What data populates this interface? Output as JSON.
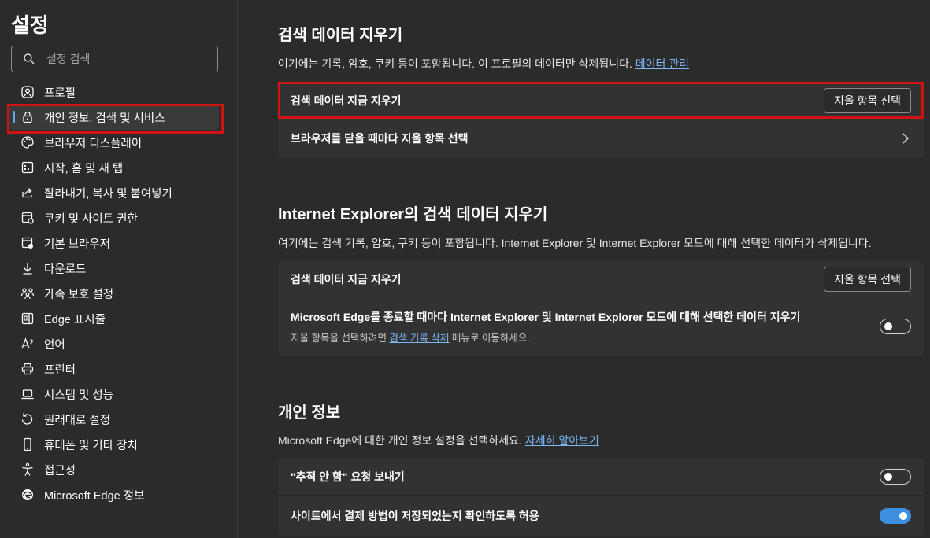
{
  "sidebar": {
    "title": "설정",
    "search_placeholder": "설정 검색",
    "items": [
      {
        "label": "프로필",
        "icon": "profile-icon"
      },
      {
        "label": "개인 정보, 검색 및 서비스",
        "icon": "lock-icon",
        "active": true
      },
      {
        "label": "브라우저 디스플레이",
        "icon": "palette-icon"
      },
      {
        "label": "시작, 홈 및 새 탭",
        "icon": "grid-icon"
      },
      {
        "label": "잘라내기, 복사 및 붙여넣기",
        "icon": "share-icon"
      },
      {
        "label": "쿠키 및 사이트 권한",
        "icon": "site-permissions-icon"
      },
      {
        "label": "기본 브라우저",
        "icon": "browser-icon"
      },
      {
        "label": "다운로드",
        "icon": "download-icon"
      },
      {
        "label": "가족 보호 설정",
        "icon": "family-icon"
      },
      {
        "label": "Edge 표시줄",
        "icon": "edge-bar-icon"
      },
      {
        "label": "언어",
        "icon": "language-icon"
      },
      {
        "label": "프린터",
        "icon": "printer-icon"
      },
      {
        "label": "시스템 및 성능",
        "icon": "laptop-icon"
      },
      {
        "label": "원래대로 설정",
        "icon": "reset-icon"
      },
      {
        "label": "휴대폰 및 기타 장치",
        "icon": "phone-icon"
      },
      {
        "label": "접근성",
        "icon": "accessibility-icon"
      },
      {
        "label": "Microsoft Edge 정보",
        "icon": "edge-logo-icon"
      }
    ]
  },
  "clear_data": {
    "title": "검색 데이터 지우기",
    "desc": "여기에는 기록, 암호, 쿠키 등이 포함됩니다. 이 프로필의 데이터만 삭제됩니다.",
    "desc_link": "데이터 관리",
    "row1_label": "검색 데이터 지금 지우기",
    "row1_button": "지울 항목 선택",
    "row2_label": "브라우저를 닫을 때마다 지울 항목 선택"
  },
  "ie_data": {
    "title": "Internet Explorer의 검색 데이터 지우기",
    "desc": "여기에는 검색 기록, 암호, 쿠키 등이 포함됩니다. Internet Explorer 및 Internet Explorer 모드에 대해 선택한 데이터가 삭제됩니다.",
    "row1_label": "검색 데이터 지금 지우기",
    "row1_button": "지울 항목 선택",
    "row2_label": "Microsoft Edge를 종료할 때마다 Internet Explorer 및 Internet Explorer 모드에 대해 선택한 데이터 지우기",
    "row2_sub_pre": "지울 항목을 선택하려면",
    "row2_sub_link": "검색 기록 삭제",
    "row2_sub_post": "메뉴로 이동하세요.",
    "row2_toggle_on": false
  },
  "privacy": {
    "title": "개인 정보",
    "desc": "Microsoft Edge에 대한 개인 정보 설정을 선택하세요.",
    "desc_link": "자세히 알아보기",
    "row1_label": "\"추적 안 함\" 요청 보내기",
    "row1_toggle_on": false,
    "row2_label": "사이트에서 결제 방법이 저장되었는지 확인하도록 허용",
    "row2_toggle_on": true
  },
  "colors": {
    "accent": "#3c8fe0",
    "link": "#7cb8f7",
    "highlight": "#d01414"
  }
}
